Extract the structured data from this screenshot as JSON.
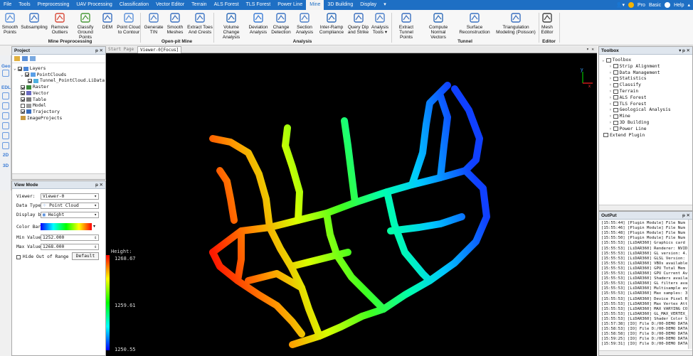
{
  "menu": {
    "items": [
      "File",
      "Tools",
      "Preprocessing",
      "UAV Processing",
      "Classification",
      "Vector Editor",
      "Terrain",
      "ALS Forest",
      "TLS Forest",
      "Power Line",
      "Mine",
      "3D Building",
      "Display"
    ],
    "active_index": 10,
    "more": "▾",
    "right": {
      "pro": "Pro",
      "basic": "Basic",
      "help": "Help"
    }
  },
  "ribbon": {
    "buttons": [
      {
        "label": "Smooth\nPoints"
      },
      {
        "label": "Subsampling"
      },
      {
        "label": "Remove\nOutliers"
      },
      {
        "label": "Classify Ground\nPoints"
      },
      {
        "label": "DEM"
      },
      {
        "label": "Point Cloud\nto Contour"
      },
      {
        "label": "Generate\nTIN"
      },
      {
        "label": "Smooth\nMeshes"
      },
      {
        "label": "Extract Toes\nAnd Crests"
      },
      {
        "label": "Volume Change\nAnalysis"
      },
      {
        "label": "Deviation\nAnalysis"
      },
      {
        "label": "Change\nDetection"
      },
      {
        "label": "Section\nAnalysis"
      },
      {
        "label": "Inter-Ramp\nCompliance"
      },
      {
        "label": "Query Dip\nand Strike"
      },
      {
        "label": "Analysis\nTools ▾"
      },
      {
        "label": "Extract Tunnel\nPoints"
      },
      {
        "label": "Compute Normal\nVectors"
      },
      {
        "label": "Surface\nReconstruction"
      },
      {
        "label": "Triangulation\nModeling (Poisson)"
      },
      {
        "label": "Mesh\nEditor"
      }
    ],
    "groups": [
      "Mine Preprocessing",
      "Open-pit Mine",
      "Analysis",
      "Tunnel",
      "Editor"
    ]
  },
  "project": {
    "title": "Project",
    "pin": "ᵽ ✕",
    "tree": [
      {
        "label": "Layers"
      },
      {
        "label": "PointClouds"
      },
      {
        "label": "Tunnel_PointCloud.LiData"
      },
      {
        "label": "Raster"
      },
      {
        "label": "Vector"
      },
      {
        "label": "Table"
      },
      {
        "label": "Model"
      },
      {
        "label": "Trajectory"
      },
      {
        "label": "ImageProjects"
      }
    ]
  },
  "sidetools": [
    "Geo",
    "EDL",
    "2D",
    "3D"
  ],
  "viewmode": {
    "title": "View Mode",
    "viewer_label": "Viewer:",
    "viewer_value": "Viewer-0",
    "datatype_label": "Data Type:",
    "datatype_value": "Point Cloud",
    "display_label": "Display by:",
    "display_value": "Height",
    "colorbar_label": "Color Bar:",
    "min_label": "Min Value:",
    "min_value": "1252.000",
    "max_label": "Max Value:",
    "max_value": "1268.000",
    "hide_label": "Hide Out of Range",
    "default_button": "Default"
  },
  "viewer": {
    "tab_start": "Start Page",
    "tab_viewer": "Viewer-0[Focus]",
    "tab_controls": "▾ ✕",
    "axis_y": "y",
    "axis_x": "x",
    "legend_title": "Height:",
    "legend_max": "1268.67",
    "legend_mid": "1259.61",
    "legend_min": "1250.55"
  },
  "toolbox": {
    "title": "Toolbox",
    "pin": "▾ ᵽ ✕",
    "items": [
      "Toolbox",
      "Strip Alignment",
      "Data Management",
      "Statistics",
      "Classify",
      "Terrain",
      "ALS Forest",
      "TLS Forest",
      "Geological Analysis",
      "Mine",
      "3D Building",
      "Power Line",
      "Extend Plugin"
    ]
  },
  "output": {
    "title": "OutPut",
    "pin": "ᵽ ✕",
    "lines": [
      "[15:55:44] [Plugin Module]     File Num",
      "[15:55:46] [Plugin Module]     File Num",
      "[15:55:48] [Plugin Module]     File Num",
      "[15:55:50] [Plugin Module]     File Num",
      "[15:55:53] [LiDAR360]     Graphics card",
      "[15:55:53] [LiDAR360]     Renderer: NVID",
      "[15:55:53] [LiDAR360]     GL version: 4.",
      "[15:55:53] [LiDAR360]     GLSL Version:",
      "[15:55:53] [LiDAR360]     VBOs available",
      "[15:55:53] [LiDAR360]     GPU Total Mem",
      "[15:55:53] [LiDAR360]     GPU Current Av",
      "[15:55:53] [LiDAR360]     Shaders availa",
      "[15:55:53] [LiDAR360]     GL filters ava",
      "[15:55:53] [LiDAR360]     Multisample av",
      "[15:55:53] [LiDAR360]     Max samples: 3",
      "[15:55:53] [LiDAR360]     Device Pixel R",
      "[15:55:53] [LiDAR360]     Max Vertex Att",
      "[15:55:53] [LiDAR360]     MAX VARYING CO",
      "[15:55:53] [LiDAR360]     GL_MAX_VERTEX_",
      "[15:55:53] [LiDAR360]     Shader Color S",
      "[15:57:38] [IO]     File D:/00-DEMO DATA",
      "[15:58:53] [IO]     File D:/00-DEMO DATA",
      "[15:58:58] [IO]     File D:/00-DEMO DATA",
      "[15:59:25] [IO]     File D:/00-DEMO DATA",
      "[15:59:31] [IO]     File D:/00-DEMO DATA"
    ]
  },
  "colors": {
    "menubar": "#1e6fc4",
    "panel_title": "#dfe6ee",
    "viewer_bg": "#000000"
  }
}
